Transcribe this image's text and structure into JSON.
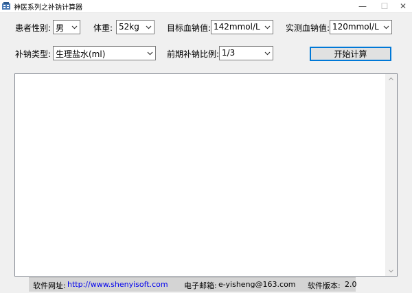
{
  "window": {
    "title": "神医系列之补钠计算器",
    "minimize_glyph": "—",
    "maximize_glyph": "☐",
    "close_glyph": "✕",
    "icon": "app-icon"
  },
  "form": {
    "gender": {
      "label": "患者性别:",
      "value": "男"
    },
    "weight": {
      "label": "体重:",
      "value": "52kg"
    },
    "target_sodium": {
      "label": "目标血钠值:",
      "value": "142mmol/L"
    },
    "measured_sodium": {
      "label": "实测血钠值:",
      "value": "120mmol/L"
    },
    "supplement_type": {
      "label": "补钠类型:",
      "value": "生理盐水(ml)"
    },
    "early_ratio": {
      "label": "前期补钠比例:",
      "value": "1/3"
    }
  },
  "actions": {
    "start_label": "开始计算"
  },
  "output": {
    "text": ""
  },
  "footer": {
    "website_label": "软件网址:",
    "website": "http://www.shenyisoft.com",
    "email_label": "电子邮箱:",
    "email": "e-yisheng@163.com",
    "version_label": "软件版本:",
    "version": "2.0"
  },
  "colors": {
    "accent": "#0078d7",
    "link": "#0000ee",
    "footer_bg": "#d4d4d4"
  }
}
